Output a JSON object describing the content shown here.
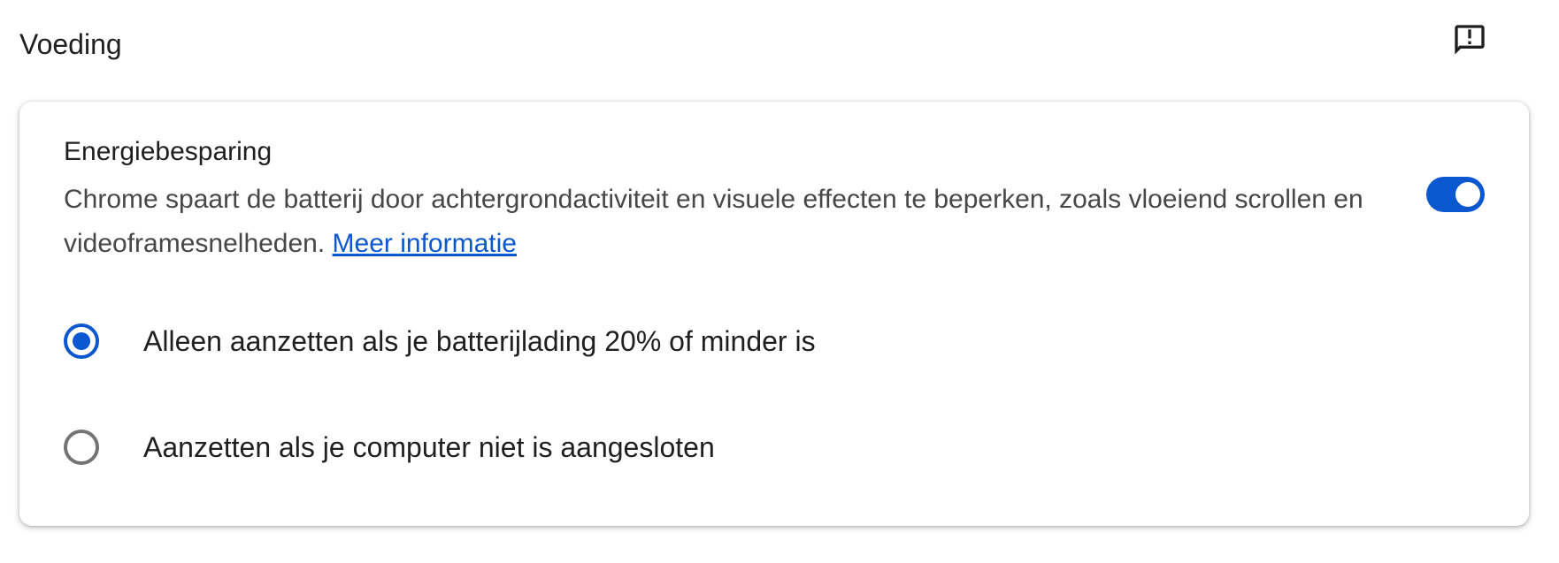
{
  "section": {
    "title": "Voeding",
    "feedback_icon": "feedback-icon"
  },
  "energy_saver": {
    "label": "Energiebesparing",
    "description": "Chrome spaart de batterij door achtergrondactiviteit en visuele effecten te beperken, zoals vloeiend scrollen en videoframesnelheden.",
    "learn_more": "Meer informatie",
    "enabled": true
  },
  "options": [
    {
      "label": "Alleen aanzetten als je batterijlading 20% of minder is",
      "selected": true
    },
    {
      "label": "Aanzetten als je computer niet is aangesloten",
      "selected": false
    }
  ],
  "colors": {
    "accent": "#0b57d0",
    "text": "#1f1f1f",
    "secondary_text": "#474747",
    "radio_unchecked": "#757575"
  }
}
